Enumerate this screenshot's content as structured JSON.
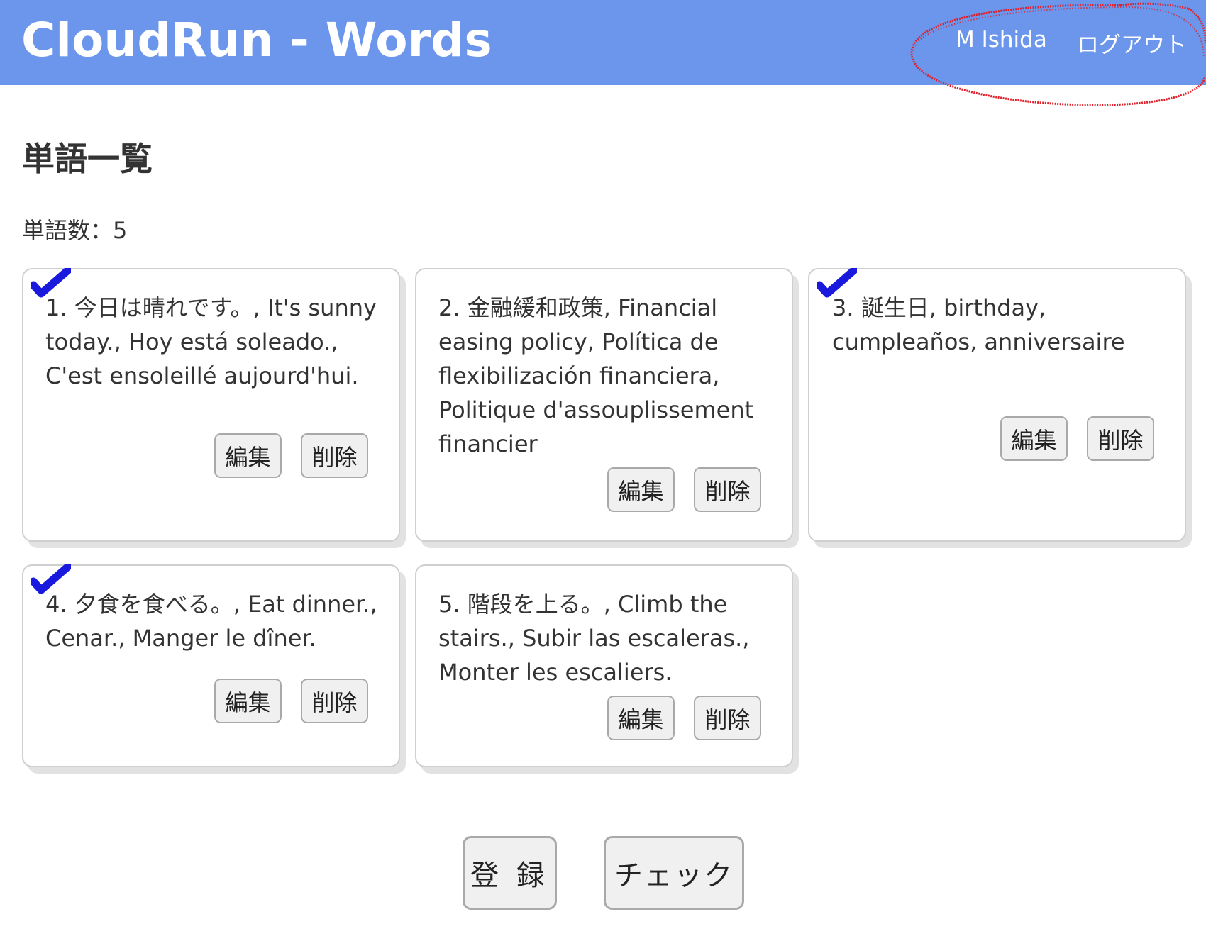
{
  "header": {
    "title": "CloudRun - Words",
    "user_name": "M Ishida",
    "logout_label": "ログアウト",
    "background_color": "#6b96ec",
    "highlight_color": "#e0202a"
  },
  "main": {
    "page_title": "単語一覧",
    "word_count_label": "単語数：5"
  },
  "cards": [
    {
      "text": "1. 今日は晴れです。, It's sunny today., Hoy está soleado., C'est ensoleillé aujourd'hui.",
      "checked": true,
      "edit_label": "編集",
      "delete_label": "削除"
    },
    {
      "text": "2. 金融緩和政策, Financial easing policy, Política de flexibilización financiera, Politique d'assouplissement financier",
      "checked": false,
      "edit_label": "編集",
      "delete_label": "削除"
    },
    {
      "text": "3. 誕生日, birthday, cumpleaños, anniversaire",
      "checked": true,
      "edit_label": "編集",
      "delete_label": "削除"
    },
    {
      "text": "4. 夕食を食べる。, Eat dinner., Cenar., Manger le dîner.",
      "checked": true,
      "edit_label": "編集",
      "delete_label": "削除"
    },
    {
      "text": "5. 階段を上る。, Climb the stairs., Subir las escaleras., Monter les escaliers.",
      "checked": false,
      "edit_label": "編集",
      "delete_label": "削除"
    }
  ],
  "actions": {
    "register_label": "登 録",
    "check_label": "チェック"
  },
  "check_mark_color": "#1a1adf"
}
